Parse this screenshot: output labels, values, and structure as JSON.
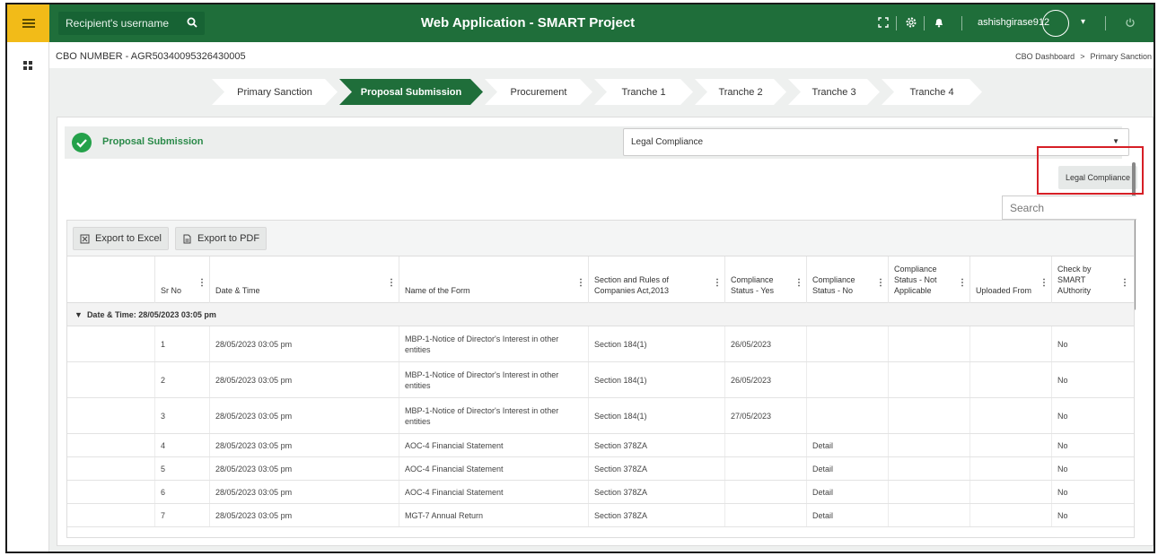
{
  "topbar": {
    "search_placeholder": "Recipient's username",
    "title": "Web Application - SMART Project",
    "username": "ashishgirase912",
    "icons": [
      "fullscreen-icon",
      "settings-icon",
      "bell-icon",
      "power-icon"
    ]
  },
  "header": {
    "cbo_number": "CBO NUMBER - AGR50340095326430005",
    "breadcrumb": [
      "CBO Dashboard",
      ">",
      "Primary Sanction"
    ]
  },
  "stepper": {
    "steps": [
      "Primary Sanction",
      "Proposal Submission",
      "Procurement",
      "Tranche 1",
      "Tranche 2",
      "Tranche 3",
      "Tranche 4"
    ],
    "active_index": 1
  },
  "section": {
    "label": "Proposal Submission",
    "dropdown_value": "Legal Compliance",
    "dropdown_option": "Legal Compliance",
    "search_placeholder": "Search"
  },
  "grid": {
    "export_excel": "Export to Excel",
    "export_pdf": "Export to PDF",
    "columns": [
      "",
      "Sr No",
      "Date & Time",
      "Name of the Form",
      "Section and Rules of Companies Act,2013",
      "Compliance Status - Yes",
      "Compliance Status - No",
      "Compliance Status - Not Applicable",
      "Uploaded From",
      "Check by SMART AUthority"
    ],
    "group_label": "Date & Time: 28/05/2023 03:05 pm",
    "rows": [
      {
        "sr": "1",
        "datetime": "28/05/2023 03:05 pm",
        "form": "MBP-1-Notice of Director's Interest in other entities",
        "section": "Section 184(1)",
        "yes": "26/05/2023",
        "no": "",
        "na": "",
        "uploaded": "",
        "check": "No"
      },
      {
        "sr": "2",
        "datetime": "28/05/2023 03:05 pm",
        "form": "MBP-1-Notice of Director's Interest in other entities",
        "section": "Section 184(1)",
        "yes": "26/05/2023",
        "no": "",
        "na": "",
        "uploaded": "",
        "check": "No"
      },
      {
        "sr": "3",
        "datetime": "28/05/2023 03:05 pm",
        "form": "MBP-1-Notice of Director's Interest in other entities",
        "section": "Section 184(1)",
        "yes": "27/05/2023",
        "no": "",
        "na": "",
        "uploaded": "",
        "check": "No"
      },
      {
        "sr": "4",
        "datetime": "28/05/2023 03:05 pm",
        "form": "AOC-4 Financial Statement",
        "section": "Section 378ZA",
        "yes": "",
        "no": "Detail",
        "na": "",
        "uploaded": "",
        "check": "No"
      },
      {
        "sr": "5",
        "datetime": "28/05/2023 03:05 pm",
        "form": "AOC-4 Financial Statement",
        "section": "Section 378ZA",
        "yes": "",
        "no": "Detail",
        "na": "",
        "uploaded": "",
        "check": "No"
      },
      {
        "sr": "6",
        "datetime": "28/05/2023 03:05 pm",
        "form": "AOC-4 Financial Statement",
        "section": "Section 378ZA",
        "yes": "",
        "no": "Detail",
        "na": "",
        "uploaded": "",
        "check": "No"
      },
      {
        "sr": "7",
        "datetime": "28/05/2023 03:05 pm",
        "form": "MGT-7 Annual Return",
        "section": "Section 378ZA",
        "yes": "",
        "no": "Detail",
        "na": "",
        "uploaded": "",
        "check": "No"
      }
    ]
  },
  "colors": {
    "brand_green": "#1f6e3a",
    "menu_yellow": "#f2bb18",
    "check_green": "#24a14a",
    "highlight_red": "#d61f26"
  }
}
